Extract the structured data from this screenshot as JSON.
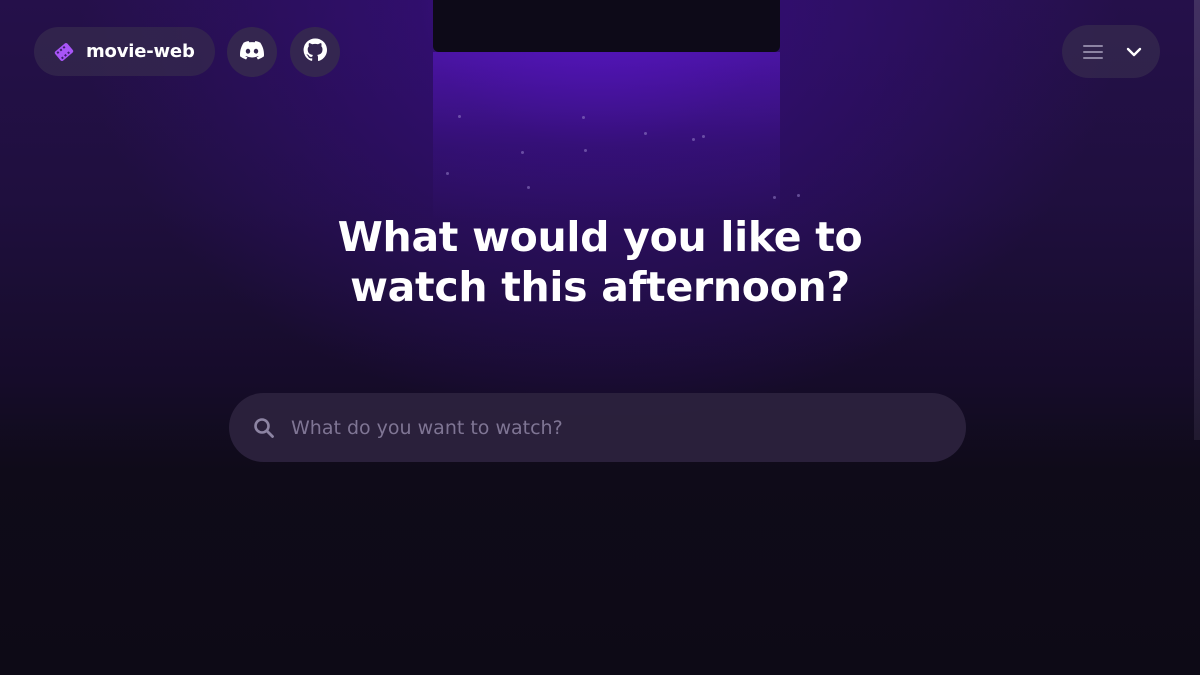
{
  "header": {
    "brand": {
      "label": "movie-web",
      "icon": "film-icon",
      "icon_color": "#a855f7"
    },
    "discord": {
      "icon": "discord-icon"
    },
    "github": {
      "icon": "github-icon"
    },
    "menu": {
      "icon": "hamburger-menu-icon",
      "chevron": "chevron-down-icon"
    }
  },
  "hero": {
    "title_line1": "What would you like to",
    "title_line2": "watch this afternoon?"
  },
  "search": {
    "placeholder": "What do you want to watch?",
    "value": "",
    "icon": "search-icon"
  },
  "theme": {
    "background": "#0d0a16",
    "accent": "#a855f7",
    "glow": "#4810a8"
  }
}
